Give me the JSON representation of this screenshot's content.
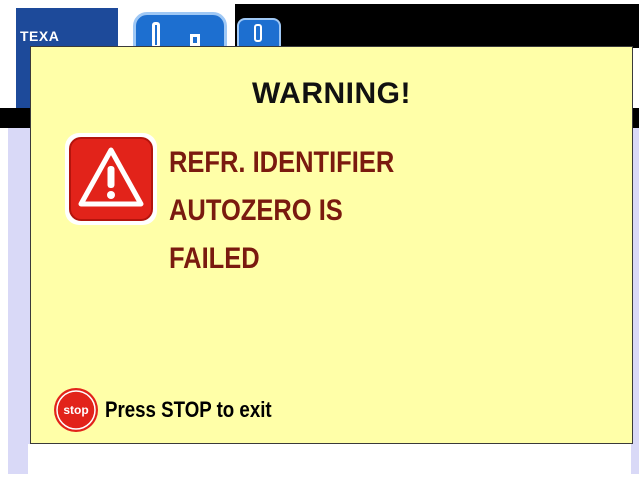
{
  "background": {
    "logo_text": "TEXA"
  },
  "dialog": {
    "title": "WARNING!",
    "message_lines": [
      "REFR. IDENTIFIER",
      "AUTOZERO IS",
      "FAILED"
    ],
    "stop_icon_text": "stop",
    "stop_label": "Press STOP to exit"
  },
  "colors": {
    "dialog_bg": "#ffffa8",
    "message_text": "#7a1a0f",
    "warning_red": "#e2231a",
    "brand_blue": "#1d4a9a",
    "panel_bg": "#d9d9f7"
  },
  "icons": {
    "warning": "warning-triangle-icon",
    "stop": "stop-sign-icon"
  }
}
